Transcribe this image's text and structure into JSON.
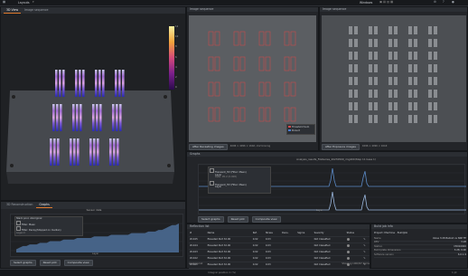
{
  "topbar": {
    "title": "Layouts",
    "window_label": "Windows",
    "menu_icons": [
      "settings-icon",
      "help-icon",
      "user-icon"
    ]
  },
  "view3d": {
    "tab": "3D View",
    "tab2": "Image sequence",
    "colorbar_min": "-",
    "colorbar_label": "Dose",
    "colorbar_ticks": [
      "12",
      "10",
      "8",
      "6",
      "4",
      "2",
      "0"
    ]
  },
  "imgseq1": {
    "title": "Image sequence",
    "footer_left": "After Recasting images",
    "footer_info": "4096 × 4096 × 16bit, 2x2 binning",
    "legend": [
      "Threshold Sum",
      "Pursuit"
    ]
  },
  "imgseq2": {
    "title": "Image sequence",
    "footer_left": "After Exposure images",
    "footer_info": "4096 × 4096 × 16bit"
  },
  "graphs_bottom": {
    "tabs": [
      "3D Reconstruction",
      "Graphs"
    ],
    "title": "Sensor data",
    "legend_top": "Stack pool, Aboriginal",
    "legend_line1": "Filter: Mean",
    "legend_line2": "Filter: Decay(Stopped on median)",
    "legend_line3": "Legend",
    "select_btn": "Select graphs",
    "reset_btn": "Reset plot",
    "comp_btn": "Composite view",
    "chart_xlabel": "Layer"
  },
  "graphs_main": {
    "title": "Graphs",
    "subtitle": "Analysis_results_FileSeries_20230509_img400(Step 11 base 1)",
    "legend1": "Transient_HV (Filter: Mean)",
    "legend2": "Layer",
    "legend3": "Transient_HV (Filter: Mean)",
    "legend4": "Layer",
    "legend_extra": "Peak: 95.2 (0.008)",
    "select_btn": "Select graphs",
    "reset_btn": "Reset plot",
    "comp_btn": "Composite view",
    "xlabel": "Layer"
  },
  "table_panel": {
    "title": "Reflection list",
    "columns": [
      "#",
      "Name",
      "Ref.",
      "Stress",
      "Dens.",
      "Sigma",
      "Severity",
      "Status",
      "",
      "",
      ""
    ],
    "rows": [
      [
        "#1105",
        "Elevated Part 32.00",
        "0.02",
        "0.03",
        "",
        "",
        "Not Classified"
      ],
      [
        "#1104",
        "Elevated Part 32.00",
        "0.02",
        "0.03",
        "",
        "",
        "Not Classified"
      ],
      [
        "#1103",
        "Elevated Part 32.00",
        "0.02",
        "0.03",
        "",
        "",
        "Not Classified"
      ],
      [
        "#1102",
        "Elevated Part 32.00",
        "0.02",
        "0.03",
        "",
        "",
        "Not Classified"
      ],
      [
        "#1101",
        "Elevated Part 32.00",
        "0.02",
        "0.03",
        "",
        "",
        "Not Classified"
      ]
    ],
    "footer": "Analysis list",
    "showing": "Showing 1000/97 items"
  },
  "props": {
    "title": "Build job info",
    "sub": "Project: Machine · BuildJob",
    "rows": [
      [
        "Name",
        "Value 3:28 Balloid vs NSE FE"
      ],
      [
        "DEV",
        "3.28"
      ],
      [
        "Station",
        "D5010000"
      ],
      [
        "Build plate dimensions",
        "3.28, 9.90"
      ],
      [
        "Software version",
        "6.0.1.9"
      ]
    ]
  },
  "status": {
    "left": "Integral position 1 (%)",
    "right": "1 pt"
  },
  "charts": {
    "main": {
      "type": "line",
      "series": [
        {
          "color": "#5b8ac6",
          "peaks": [
            0.5,
            0.62
          ]
        },
        {
          "color": "#9ab7de",
          "peaks": [
            0.5,
            0.62
          ]
        }
      ]
    },
    "bottom": {
      "type": "area",
      "values": [
        2,
        3,
        4,
        4,
        5,
        5,
        5,
        6,
        6,
        6,
        7,
        7,
        7,
        7,
        8,
        8,
        8,
        8,
        9,
        9,
        9,
        9,
        9,
        10,
        10,
        10,
        10,
        10,
        11,
        11,
        11,
        11,
        11,
        11,
        12,
        12,
        12,
        12,
        12,
        13,
        13,
        13,
        14,
        14,
        15,
        16,
        17,
        17,
        18
      ]
    }
  }
}
